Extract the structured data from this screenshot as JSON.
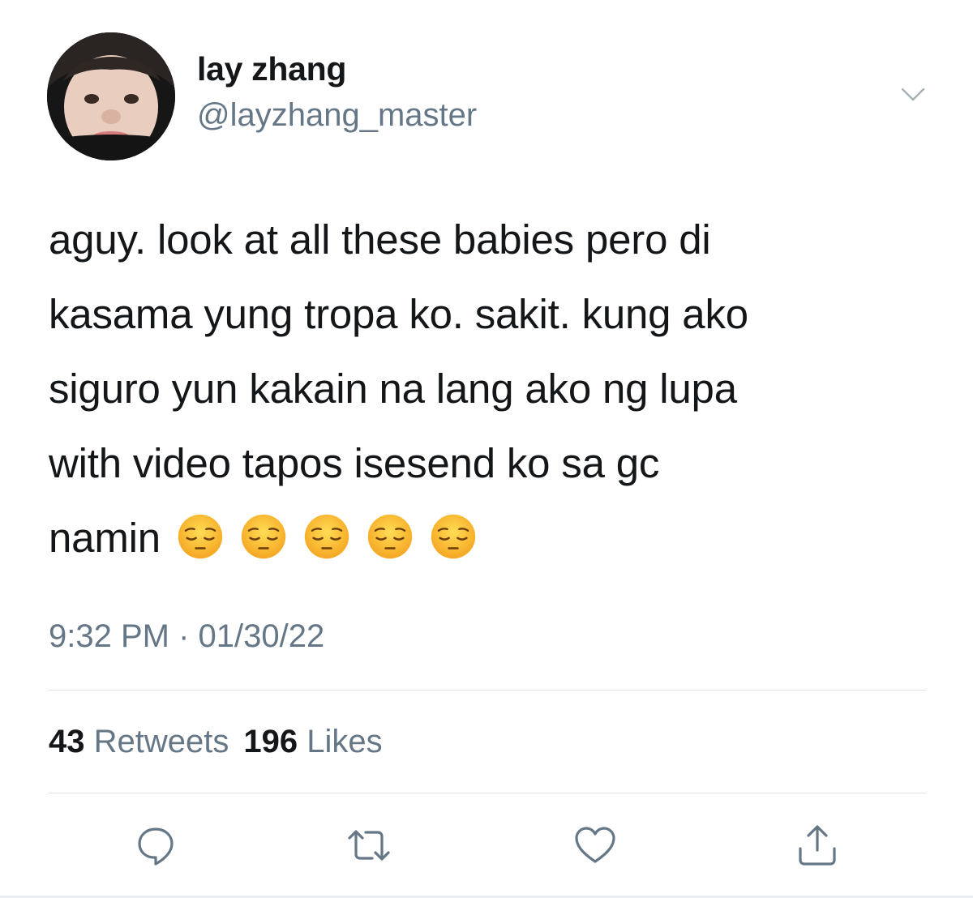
{
  "user": {
    "display_name": "lay zhang",
    "handle": "@layzhang_master"
  },
  "tweet": {
    "lines": [
      "aguy. look at all these babies pero di",
      "kasama yung tropa ko. sakit. kung ako",
      "siguro yun kakain na lang ako ng lupa",
      "with video tapos isesend ko sa gc",
      "namin"
    ],
    "emoji_count": 5,
    "emoji": "pensive-face"
  },
  "meta": {
    "timestamp": "9:32 PM · 01/30/22"
  },
  "stats": {
    "retweets_count": "43",
    "retweets_label": "Retweets",
    "likes_count": "196",
    "likes_label": "Likes"
  },
  "icons": {
    "more": "chevron-down-icon",
    "reply": "reply-icon",
    "retweet": "retweet-icon",
    "like": "heart-icon",
    "share": "share-icon"
  },
  "colors": {
    "text_primary": "#14171a",
    "text_secondary": "#657786",
    "divider": "#dde3e8",
    "icon": "#657786"
  }
}
